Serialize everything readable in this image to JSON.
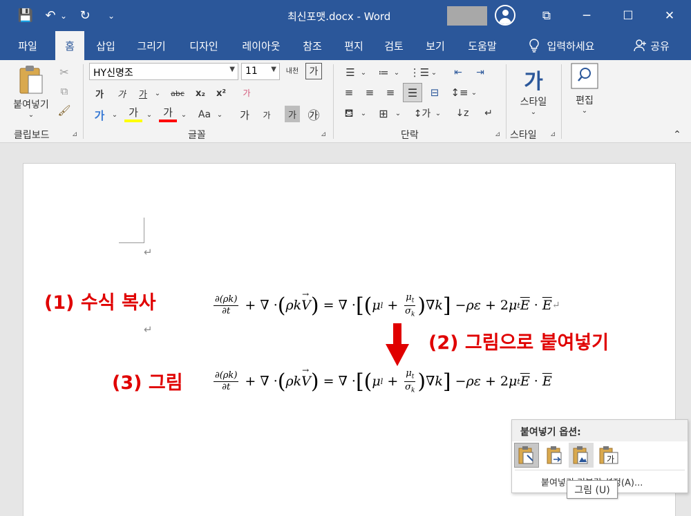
{
  "titlebar": {
    "title": "최신포맷.docx  -  Word",
    "qa_save": "💾",
    "qa_undo": "↶",
    "qa_undo_dd": "⌄",
    "qa_redo": "↻",
    "qa_customize": "⌄",
    "ribbon_display": "⧉",
    "minimize": "─",
    "maximize": "☐",
    "close": "✕"
  },
  "tabs": [
    {
      "label": "파일"
    },
    {
      "label": "홈"
    },
    {
      "label": "삽입"
    },
    {
      "label": "그리기"
    },
    {
      "label": "디자인"
    },
    {
      "label": "레이아웃"
    },
    {
      "label": "참조"
    },
    {
      "label": "편지"
    },
    {
      "label": "검토"
    },
    {
      "label": "보기"
    },
    {
      "label": "도움말"
    }
  ],
  "tell_me": "입력하세요",
  "share": "공유",
  "ribbon": {
    "clipboard": {
      "label": "클립보드",
      "paste": "붙여넣기"
    },
    "font": {
      "label": "글꼴",
      "font_name": "HY신명조",
      "font_size": "11",
      "bold": "가",
      "italic": "가",
      "underline": "가",
      "strikethrough": "abc",
      "subscript": "x₂",
      "superscript": "x²",
      "clear_format": "가",
      "text_effects": "가",
      "highlight": "가",
      "font_color": "가",
      "change_case": "Aa",
      "grow": "가",
      "shrink": "가",
      "char_shade": "가",
      "enclose": "㉮",
      "phonetic": "내천",
      "char_border": "가"
    },
    "paragraph": {
      "label": "단락"
    },
    "styles": {
      "label": "스타일",
      "button": "스타일",
      "glyph": "가"
    },
    "editing": {
      "label": "편집"
    }
  },
  "document": {
    "label1": "(1) 수식 복사",
    "label2": "(2) 그림으로 붙여넣기",
    "label3": "(3) 그림",
    "para_mark": "↵"
  },
  "paste_options": {
    "title": "붙여넣기 옵션:",
    "default_link": "붙여넣기 기본값 설정(A)...",
    "tooltip": "그림 (U)"
  },
  "colors": {
    "accent": "#2b579a",
    "annotation_red": "#e00000",
    "highlight_yellow": "#ffff00",
    "font_red": "#ff0000"
  }
}
